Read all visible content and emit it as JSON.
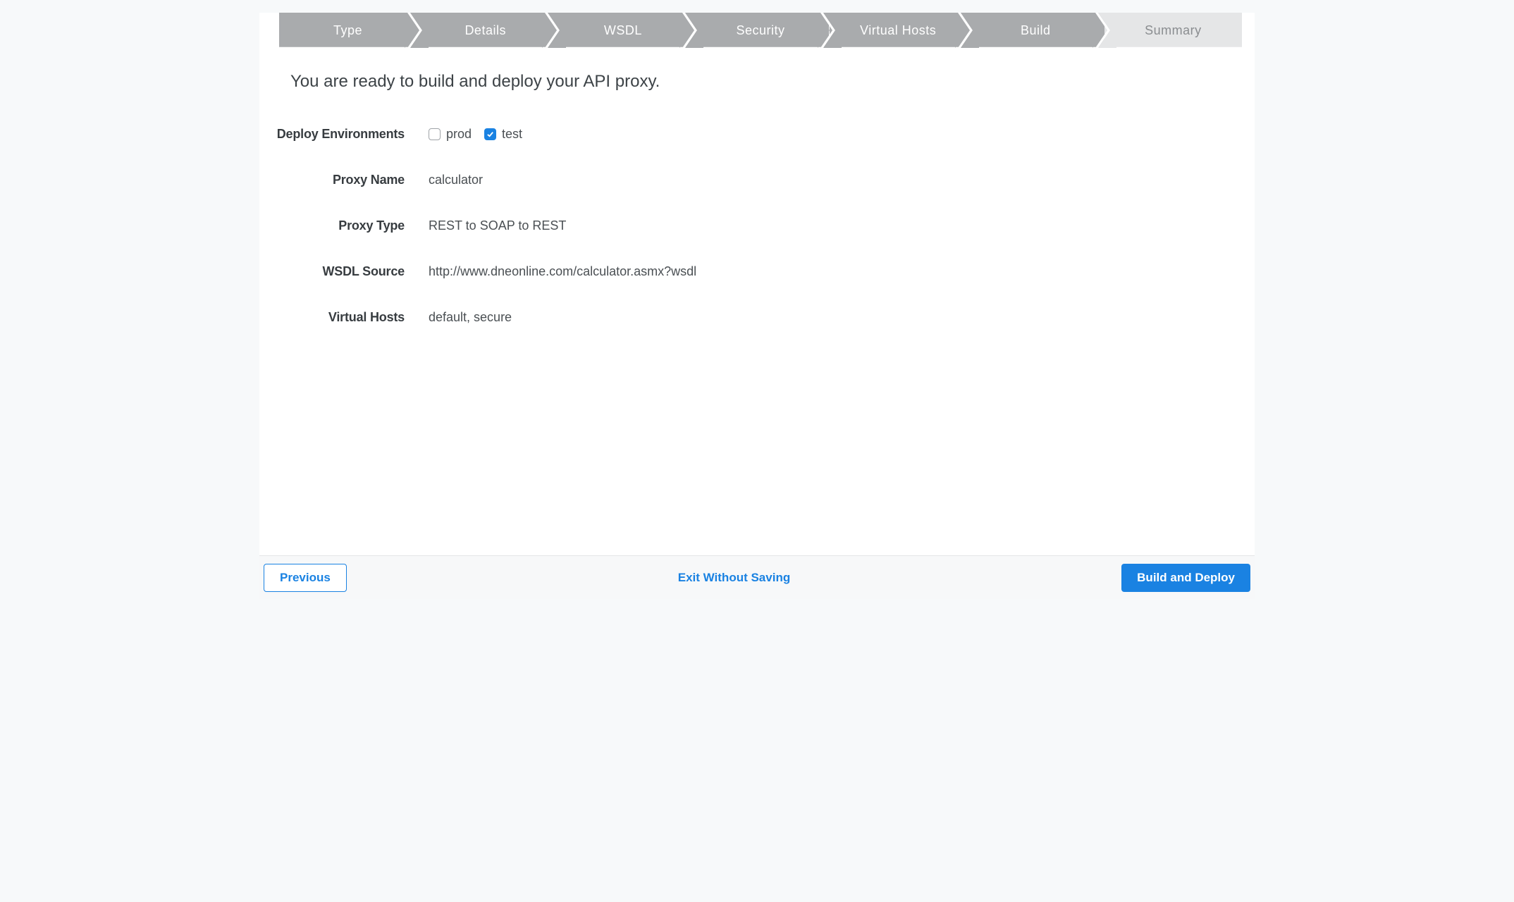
{
  "colors": {
    "step_completed": "#a9abad",
    "step_active_bg": "#e5e6e7",
    "step_divider": "#ffffff",
    "accent": "#1a82e2"
  },
  "stepper": {
    "steps": [
      {
        "label": "Type",
        "state": "completed"
      },
      {
        "label": "Details",
        "state": "completed"
      },
      {
        "label": "WSDL",
        "state": "completed"
      },
      {
        "label": "Security",
        "state": "completed"
      },
      {
        "label": "Virtual Hosts",
        "state": "completed"
      },
      {
        "label": "Build",
        "state": "completed"
      },
      {
        "label": "Summary",
        "state": "active"
      }
    ]
  },
  "heading": "You are ready to build and deploy your API proxy.",
  "summary": {
    "deploy_environments_label": "Deploy Environments",
    "environments": [
      {
        "name": "prod",
        "checked": false
      },
      {
        "name": "test",
        "checked": true
      }
    ],
    "proxy_name_label": "Proxy Name",
    "proxy_name": "calculator",
    "proxy_type_label": "Proxy Type",
    "proxy_type": "REST to SOAP to REST",
    "wsdl_source_label": "WSDL Source",
    "wsdl_source": "http://www.dneonline.com/calculator.asmx?wsdl",
    "virtual_hosts_label": "Virtual Hosts",
    "virtual_hosts": "default, secure"
  },
  "footer": {
    "previous": "Previous",
    "exit": "Exit Without Saving",
    "build_deploy": "Build and Deploy"
  }
}
